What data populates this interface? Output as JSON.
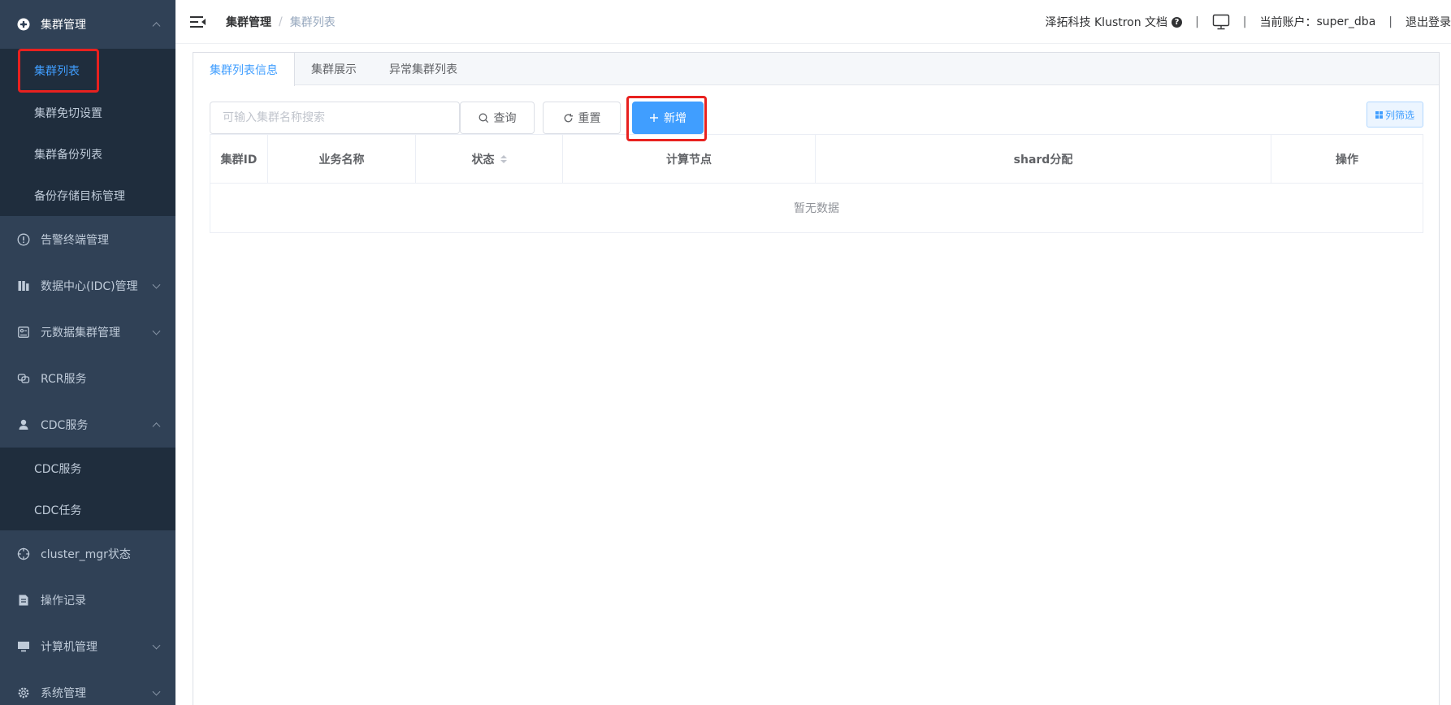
{
  "sidebar": {
    "groups": [
      {
        "label": "集群管理",
        "icon": "cluster-icon",
        "expanded": true,
        "children": [
          "集群列表",
          "集群免切设置",
          "集群备份列表",
          "备份存储目标管理"
        ],
        "active_child": "集群列表"
      },
      {
        "label": "告警终端管理",
        "icon": "alert-icon"
      },
      {
        "label": "数据中心(IDC)管理",
        "icon": "datacenter-icon",
        "collapsible": true
      },
      {
        "label": "元数据集群管理",
        "icon": "metadata-icon",
        "collapsible": true
      },
      {
        "label": "RCR服务",
        "icon": "rcr-icon"
      },
      {
        "label": "CDC服务",
        "icon": "user-icon",
        "expanded": true,
        "children": [
          "CDC服务",
          "CDC任务"
        ]
      },
      {
        "label": "cluster_mgr状态",
        "icon": "crosshair-icon"
      },
      {
        "label": "操作记录",
        "icon": "document-icon"
      },
      {
        "label": "计算机管理",
        "icon": "monitor-icon",
        "collapsible": true
      },
      {
        "label": "系统管理",
        "icon": "settings-icon",
        "collapsible": true
      }
    ]
  },
  "header": {
    "breadcrumb": [
      "集群管理",
      "集群列表"
    ],
    "separator": "/",
    "docs_link": "泽拓科技 Klustron 文档",
    "account_label": "当前账户：",
    "account_name": "super_dba",
    "logout": "退出登录",
    "divider": "|"
  },
  "tabs": [
    "集群列表信息",
    "集群展示",
    "异常集群列表"
  ],
  "active_tab": 0,
  "toolbar": {
    "search_placeholder": "可输入集群名称搜索",
    "query_label": "查询",
    "reset_label": "重置",
    "add_label": "新增",
    "column_filter_label": "列筛选"
  },
  "table": {
    "columns": [
      "集群ID",
      "业务名称",
      "状态",
      "计算节点",
      "shard分配",
      "操作"
    ],
    "sortable_column": "状态",
    "empty_text": "暂无数据"
  },
  "colors": {
    "sidebar_bg": "#304156",
    "submenu_bg": "#1f2d3d",
    "primary": "#409eff",
    "highlight_box": "#e8211f"
  }
}
